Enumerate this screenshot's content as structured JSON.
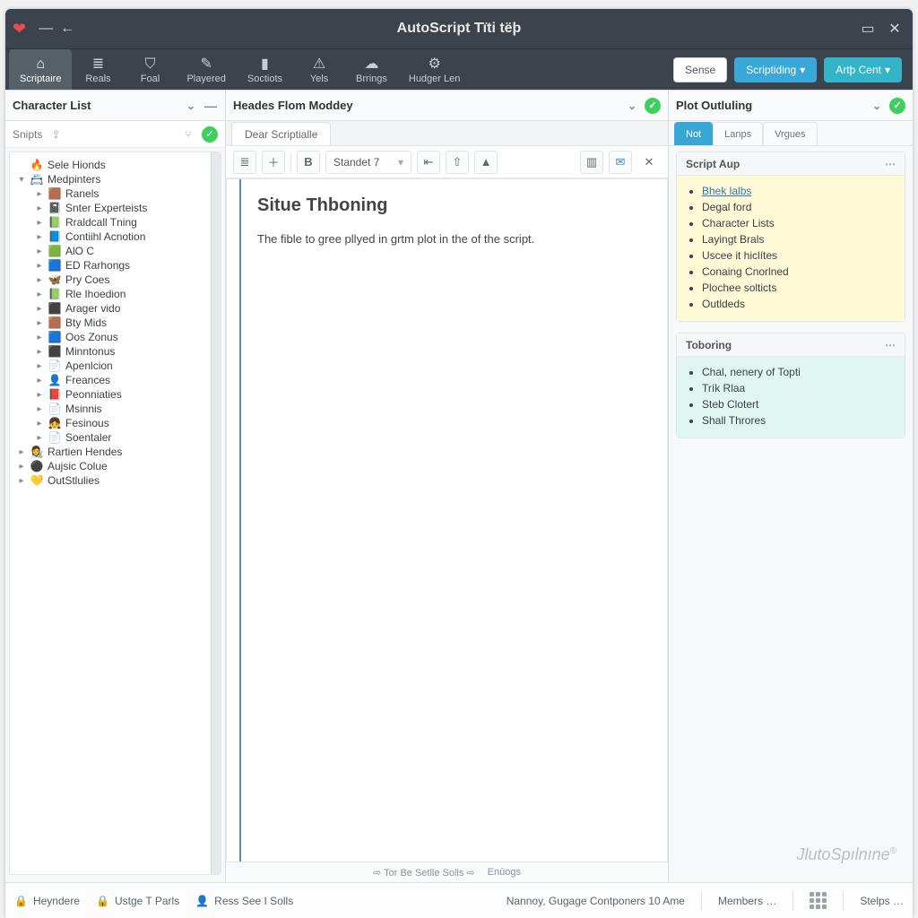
{
  "titlebar": {
    "app_title": "AutoScript Tïti tëþ"
  },
  "tabs": {
    "items": [
      {
        "icon": "⌂",
        "label": "Scriptaire",
        "active": true
      },
      {
        "icon": "≣",
        "label": "Reals"
      },
      {
        "icon": "⛉",
        "label": "Foal"
      },
      {
        "icon": "✎",
        "label": "Playered"
      },
      {
        "icon": "▮",
        "label": "Soctiots"
      },
      {
        "icon": "⚠",
        "label": "Yels"
      },
      {
        "icon": "☁",
        "label": "Brrings"
      },
      {
        "icon": "⚙",
        "label": "Hudger Len"
      }
    ],
    "right_buttons": {
      "sense": "Sense",
      "scripting": "Scriptiding",
      "arlg": "Artþ Cent"
    }
  },
  "left": {
    "title": "Character List",
    "sub": "Snipts",
    "tree": [
      {
        "d": 1,
        "tw": "",
        "em": "🔥",
        "t": "Sele Hionds"
      },
      {
        "d": 1,
        "tw": "▾",
        "em": "📇",
        "t": "Medpinters"
      },
      {
        "d": 2,
        "tw": "▸",
        "em": "🟫",
        "t": "Ranels"
      },
      {
        "d": 2,
        "tw": "▸",
        "em": "📓",
        "t": "Snter Experteists"
      },
      {
        "d": 2,
        "tw": "▸",
        "em": "📗",
        "t": "Rraldcall Tning"
      },
      {
        "d": 2,
        "tw": "▸",
        "em": "📘",
        "t": "Contiihl Acnotion"
      },
      {
        "d": 2,
        "tw": "▸",
        "em": "🟩",
        "t": "AlO C"
      },
      {
        "d": 2,
        "tw": "▸",
        "em": "🟦",
        "t": "ED Rarhongs"
      },
      {
        "d": 2,
        "tw": "▸",
        "em": "🦋",
        "t": "Pry Coes"
      },
      {
        "d": 2,
        "tw": "▸",
        "em": "📗",
        "t": "Rle Ihoedion"
      },
      {
        "d": 2,
        "tw": "▸",
        "em": "⬛",
        "t": "Arager vido"
      },
      {
        "d": 2,
        "tw": "▸",
        "em": "🟫",
        "t": "Bty Mids"
      },
      {
        "d": 2,
        "tw": "▸",
        "em": "🟦",
        "t": "Oos Zonus"
      },
      {
        "d": 2,
        "tw": "▸",
        "em": "⬛",
        "t": "Minntonus"
      },
      {
        "d": 2,
        "tw": "▸",
        "em": "📄",
        "t": "Apenlcion"
      },
      {
        "d": 2,
        "tw": "▸",
        "em": "👤",
        "t": "Freances"
      },
      {
        "d": 2,
        "tw": "▸",
        "em": "📕",
        "t": "Peonniaties"
      },
      {
        "d": 2,
        "tw": "▸",
        "em": "📄",
        "t": "Msinnis"
      },
      {
        "d": 2,
        "tw": "▸",
        "em": "👧",
        "t": "Fesinous"
      },
      {
        "d": 2,
        "tw": "▸",
        "em": "📄",
        "t": "Soentaler"
      },
      {
        "d": 1,
        "tw": "▸",
        "em": "👩‍🎨",
        "t": "Rartien Hendes"
      },
      {
        "d": 1,
        "tw": "▸",
        "em": "⚫",
        "t": "Aujsic Colue"
      },
      {
        "d": 1,
        "tw": "▸",
        "em": "💛",
        "t": "OutStlulies"
      }
    ]
  },
  "mid": {
    "title": "Heades Flom Moddey",
    "tab_label": "Dear Scriptialle",
    "style_select": "Standet 7",
    "doc": {
      "heading": "Situe Thboning",
      "body": "The fible to gree pllyed in grtm plot in the of the script."
    },
    "status_left": "⇨  Tor Be Setlle Solls  ⇨",
    "status_right": "Enùogs"
  },
  "right": {
    "title": "Plot Outluling",
    "tabs": {
      "a": "Not",
      "b": "Lanps",
      "c": "Vrgues"
    },
    "card1": {
      "title": "Script Aup",
      "items": [
        {
          "t": "Bhek lalbs",
          "link": true
        },
        {
          "t": "Degal ford"
        },
        {
          "t": "Character Lists"
        },
        {
          "t": "Layingt Brals"
        },
        {
          "t": "Uscee it hiclítes"
        },
        {
          "t": "Conaing Cnorlned"
        },
        {
          "t": "Plochee solticts"
        },
        {
          "t": "Outldeds"
        }
      ]
    },
    "card2": {
      "title": "Toboring",
      "items": [
        {
          "t": "Chal, nenery of Topti"
        },
        {
          "t": "Trík Rlaa"
        },
        {
          "t": "Steb Clotert"
        },
        {
          "t": "Shall Throres"
        }
      ]
    }
  },
  "brand": "JlutoSpılnıne",
  "footer": {
    "a": "Heyndere",
    "b": "Ustge T Parls",
    "c": "Ress See I Solls",
    "center": "Nannoy, Gugage Contponers 10 Ame",
    "members": "Members …",
    "steps": "Stelps …"
  }
}
